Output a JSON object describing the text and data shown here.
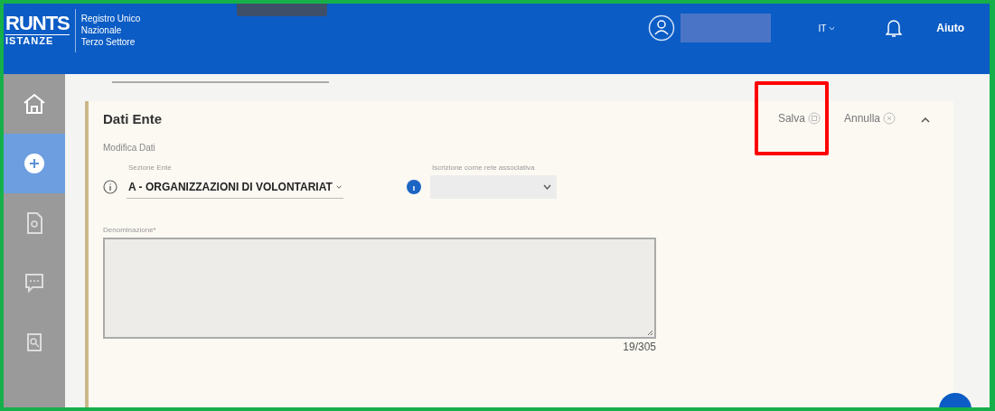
{
  "header": {
    "logo_title": "RUNTS",
    "logo_subtitle": "ISTANZE",
    "registry_lines": [
      "Registro Unico",
      "Nazionale",
      "Terzo Settore"
    ],
    "language": "IT",
    "help": "Aiuto"
  },
  "sidebar": {
    "items": [
      {
        "kind": "home",
        "selected": false
      },
      {
        "kind": "add",
        "selected": true
      },
      {
        "kind": "document",
        "selected": false
      },
      {
        "kind": "chat",
        "selected": false
      },
      {
        "kind": "search",
        "selected": false
      }
    ]
  },
  "section": {
    "title": "Dati Ente",
    "expanded": true,
    "actions": [
      {
        "label": "Salva",
        "kind": "save",
        "highlighted": true
      },
      {
        "label": "Annulla",
        "kind": "cancel",
        "highlighted": false
      }
    ],
    "subtitle": "Modifica Dati",
    "fields": [
      {
        "label": "Sezione Ente",
        "value": "A - ORGANIZZAZIONI DI VOLONTARIAT"
      },
      {
        "label": "Iscrizione come rete associativa"
      }
    ],
    "textarea": {
      "label": "Denominazione*",
      "counter": "19/305"
    }
  }
}
